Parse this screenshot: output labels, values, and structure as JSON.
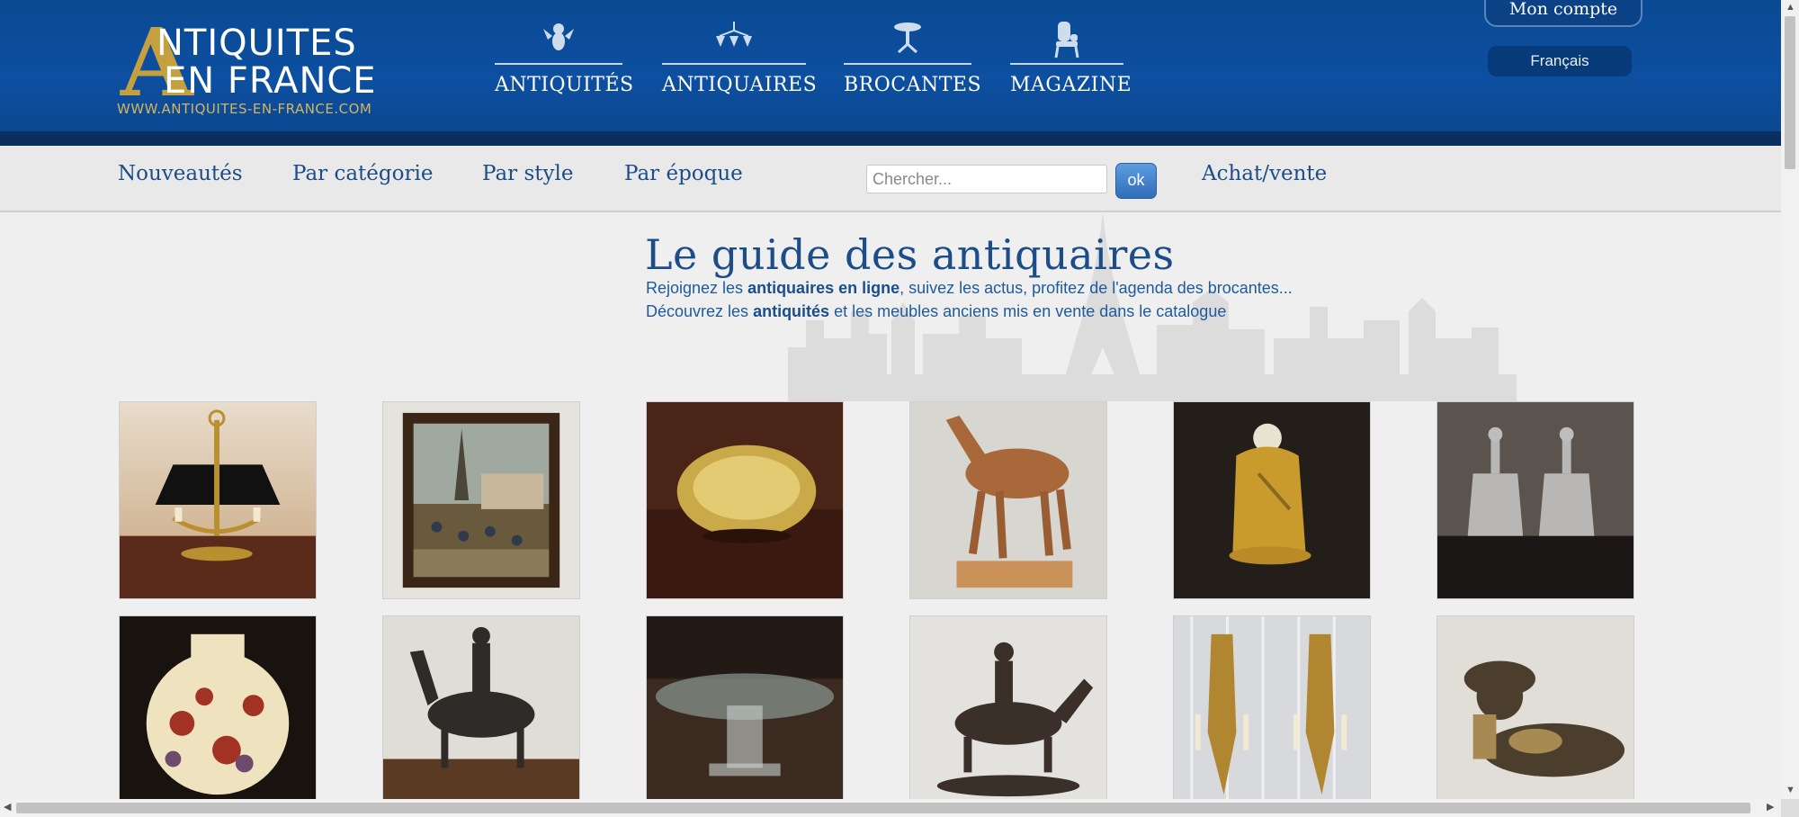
{
  "header": {
    "logo": {
      "big_letter": "A",
      "line1": "NTIQUITES",
      "line2": "EN FRANCE",
      "url": "WWW.ANTIQUITES-EN-FRANCE.COM"
    },
    "main_nav": [
      {
        "label": "ANTIQUITÉS",
        "icon": "cherub-icon"
      },
      {
        "label": "ANTIQUAIRES",
        "icon": "chandelier-icon"
      },
      {
        "label": "BROCANTES",
        "icon": "pedestal-table-icon"
      },
      {
        "label": "MAGAZINE",
        "icon": "armchair-icon"
      }
    ],
    "account_label": "Mon compte",
    "language_label": "Français"
  },
  "subnav": {
    "links": [
      "Nouveautés",
      "Par catégorie",
      "Par style",
      "Par époque"
    ],
    "search_placeholder": "Chercher...",
    "search_button": "ok",
    "trade_link": "Achat/vente"
  },
  "hero": {
    "title": "Le guide des antiquaires",
    "line1_pre": "Rejoignez les ",
    "line1_bold": "antiquaires en ligne",
    "line1_post": ", suivez les actus, profitez de l'agenda des brocantes...",
    "line2_pre": "Découvrez les ",
    "line2_bold": "antiquités",
    "line2_post": " et les meubles anciens mis en vente dans le catalogue"
  },
  "gallery": {
    "items": [
      "bouillotte-lamp-photo",
      "framed-market-painting-photo",
      "gilt-bronze-dish-photo",
      "wooden-horse-model-photo",
      "gilt-figure-statuette-photo",
      "glass-carafes-photo",
      "cameo-glass-vase-photo",
      "bronze-camel-rider-photo",
      "glass-coffee-table-photo",
      "bronze-horseman-photo",
      "gilt-wall-sconces-photo",
      "bronze-reclining-child-photo"
    ]
  },
  "colors": {
    "header_blue": "#0d4fa0",
    "gold": "#c5a03e",
    "link_blue": "#1d4d88"
  }
}
